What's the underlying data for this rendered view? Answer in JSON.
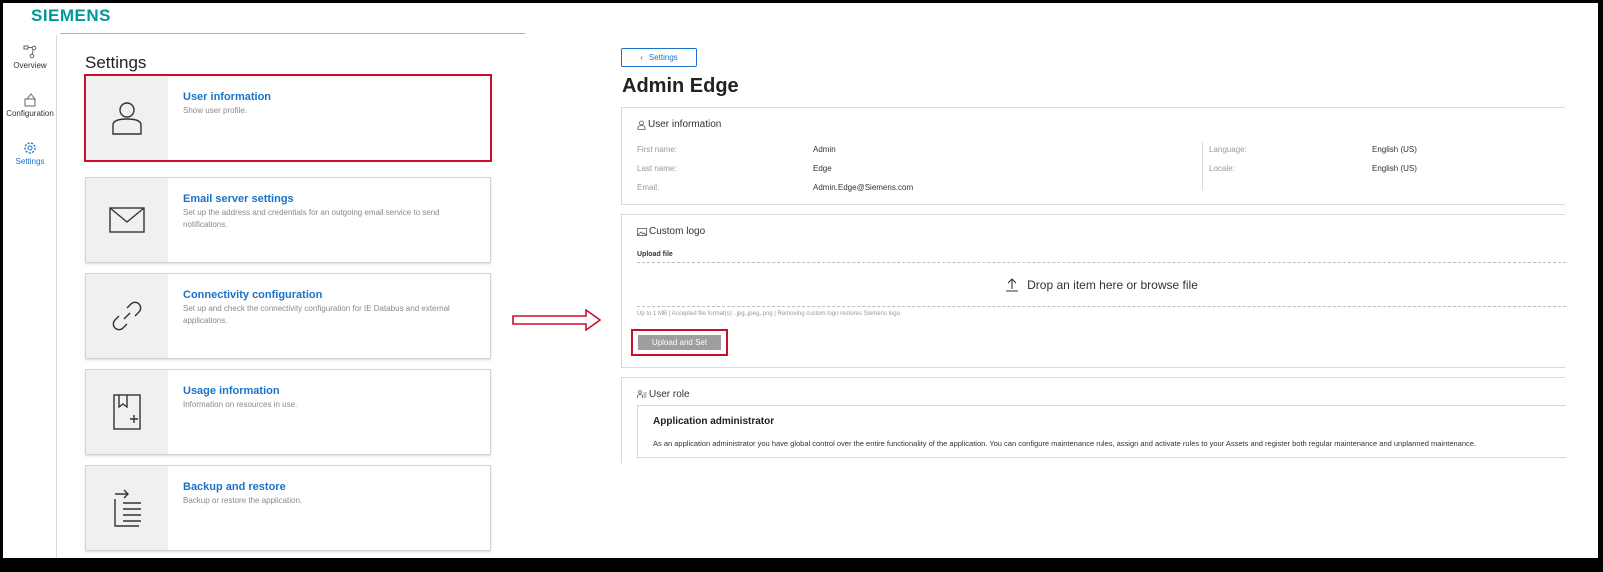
{
  "brand": {
    "logo_text": "SIEMENS"
  },
  "sidenav": {
    "items": [
      {
        "label": "Overview"
      },
      {
        "label": "Configuration"
      },
      {
        "label": "Settings",
        "active": true
      }
    ]
  },
  "settings": {
    "title": "Settings",
    "cards": [
      {
        "title": "User information",
        "desc": "Show user profile.",
        "icon": "user-icon"
      },
      {
        "title": "Email server settings",
        "desc": "Set up the address and credentials for an outgoing email service to send notifications.",
        "icon": "envelope-icon"
      },
      {
        "title": "Connectivity configuration",
        "desc": "Set up and check the connectivity configuration for IE Databus and external applications.",
        "icon": "link-icon"
      },
      {
        "title": "Usage information",
        "desc": "Information on resources in use.",
        "icon": "bookmark-plus-icon"
      },
      {
        "title": "Backup and restore",
        "desc": "Backup or restore the application.",
        "icon": "backup-list-icon"
      }
    ]
  },
  "detail": {
    "back_label": "Settings",
    "page_title": "Admin Edge",
    "user_info": {
      "heading": "User information",
      "first_name_label": "First name:",
      "first_name": "Admin",
      "last_name_label": "Last name:",
      "last_name": "Edge",
      "email_label": "Email:",
      "email": "Admin.Edge@Siemens.com",
      "language_label": "Language:",
      "language": "English (US)",
      "locale_label": "Locale:",
      "locale": "English (US)"
    },
    "custom_logo": {
      "heading": "Custom logo",
      "upload_label": "Upload file",
      "drop_text": "Drop an item here or browse file",
      "hint": "Up to 1 MB  |  Accepted file format(s): .jpg,.jpeg,.png  |  Removing custom logo restores Siemens logo.",
      "button": "Upload and Set"
    },
    "user_role": {
      "heading": "User role",
      "role_title": "Application administrator",
      "role_desc": "As an application administrator you have global control over the entire functionality of the application. You can configure maintenance rules, assign and activate rules to your Assets and register both regular maintenance and unplanned maintenance."
    }
  },
  "colors": {
    "accent": "#1a73c8",
    "brand": "#009999",
    "highlight": "#c8102e"
  }
}
